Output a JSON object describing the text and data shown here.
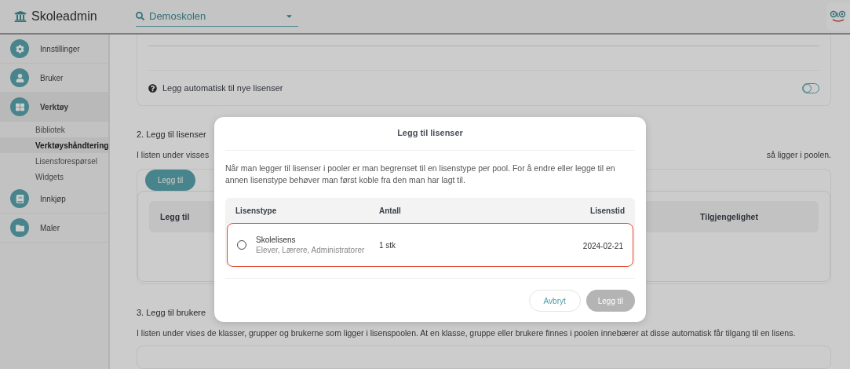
{
  "app": {
    "title": "Skoleadmin"
  },
  "school_picker": {
    "value": "Demoskolen"
  },
  "sidebar": {
    "items": [
      {
        "label": "Innstillinger",
        "selected": false
      },
      {
        "label": "Bruker",
        "selected": false
      },
      {
        "label": "Verktøy",
        "selected": true,
        "children": [
          {
            "label": "Bibliotek",
            "selected": false
          },
          {
            "label": "Verktøyshåndtering",
            "selected": true
          },
          {
            "label": "Lisensforespørsel",
            "selected": false
          },
          {
            "label": "Widgets",
            "selected": false
          }
        ]
      },
      {
        "label": "Innkjøp",
        "selected": false
      },
      {
        "label": "Maler",
        "selected": false
      }
    ]
  },
  "pool_card": {
    "auto_add": {
      "label": "Legg automatisk til nye lisenser",
      "on": false
    }
  },
  "section_2": {
    "heading": "2. Legg til lisenser",
    "text_start": "I listen under visses",
    "text_end": "så ligger i poolen.",
    "add_button": "Legg til",
    "table": {
      "columns": [
        "Legg til",
        "Tilgjengelighet"
      ]
    }
  },
  "section_3": {
    "heading": "3. Legg til brukere",
    "text": "I listen under vises de klasser, grupper og brukerne som ligger i lisenspoolen. At en klasse, gruppe eller brukere finnes i poolen innebærer at disse automatisk får tilgang til en lisens."
  },
  "dialog": {
    "title": "Legg til lisenser",
    "text": "Når man legger til lisenser i pooler er man begrenset til en lisenstype per pool. For å endre eller legge til en annen lisenstype behøver man først koble fra den man har lagt til.",
    "columns": [
      "Lisenstype",
      "Antall",
      "Lisenstid"
    ],
    "rows": [
      {
        "name": "Skolelisens",
        "roles": "Elever, Lærere, Administratorer",
        "count": "1 stk",
        "expires": "2024-02-21",
        "selected": false,
        "highlighted": true
      }
    ],
    "cancel": "Avbryt",
    "confirm": {
      "label": "Legg til",
      "disabled": true
    }
  }
}
